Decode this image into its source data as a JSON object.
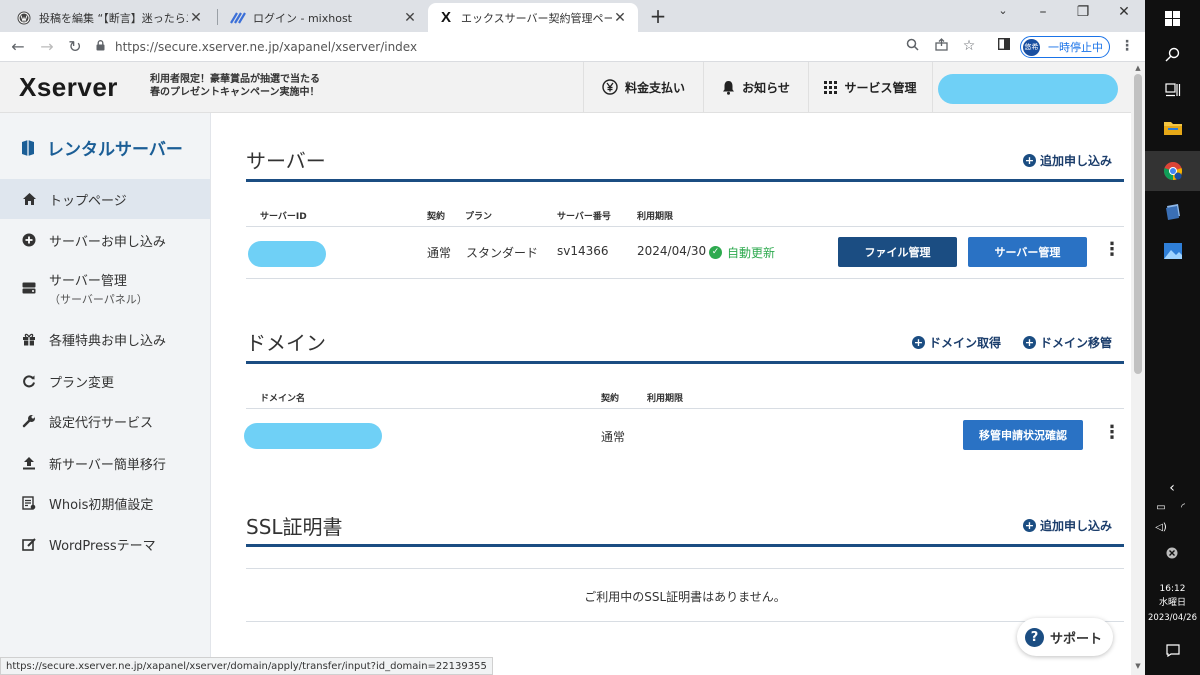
{
  "browser": {
    "tabs": [
      {
        "title": "投稿を編集 “【断言】迷ったらエックス",
        "icon": "wordpress-icon",
        "active": false
      },
      {
        "title": "ログイン - mixhost",
        "icon": "mixhost-icon",
        "active": false
      },
      {
        "title": "エックスサーバー契約管理ページ",
        "icon": "xserver-icon",
        "active": true
      }
    ],
    "url": "https://secure.xserver.ne.jp/xapanel/xserver/index",
    "profile_avatar": "悠希",
    "profile_label": "一時停止中"
  },
  "header": {
    "logo": "Xserver",
    "promo_line1": "利用者限定！豪華賞品が抽選で当たる",
    "promo_line2": "春のプレゼントキャンペーン実施中！",
    "nav": [
      {
        "label": "料金支払い",
        "icon": "yen-icon"
      },
      {
        "label": "お知らせ",
        "icon": "bell-icon"
      },
      {
        "label": "サービス管理",
        "icon": "grid-icon"
      }
    ]
  },
  "sidebar": {
    "title": "レンタルサーバー",
    "items": [
      {
        "label": "トップページ",
        "sub": "",
        "icon": "home-icon",
        "active": true
      },
      {
        "label": "サーバーお申し込み",
        "sub": "",
        "icon": "plus-circle-icon",
        "active": false
      },
      {
        "label": "サーバー管理",
        "sub": "（サーバーパネル）",
        "icon": "server-icon",
        "active": false
      },
      {
        "label": "各種特典お申し込み",
        "sub": "",
        "icon": "gift-icon",
        "active": false
      },
      {
        "label": "プラン変更",
        "sub": "",
        "icon": "refresh-icon",
        "active": false
      },
      {
        "label": "設定代行サービス",
        "sub": "",
        "icon": "wrench-icon",
        "active": false
      },
      {
        "label": "新サーバー簡単移行",
        "sub": "",
        "icon": "upload-icon",
        "active": false
      },
      {
        "label": "Whois初期値設定",
        "sub": "",
        "icon": "whois-icon",
        "active": false
      },
      {
        "label": "WordPressテーマ",
        "sub": "",
        "icon": "edit-icon",
        "active": false
      }
    ]
  },
  "server_section": {
    "title": "サーバー",
    "add_label": "追加申し込み",
    "columns": {
      "id": "サーバーID",
      "contract": "契約",
      "plan": "プラン",
      "number": "サーバー番号",
      "expiry": "利用期限"
    },
    "row": {
      "contract": "通常",
      "plan": "スタンダード",
      "number": "sv14366",
      "expiry": "2024/04/30",
      "renew": "自動更新",
      "file_btn": "ファイル管理",
      "server_btn": "サーバー管理"
    }
  },
  "domain_section": {
    "title": "ドメイン",
    "acquire_label": "ドメイン取得",
    "transfer_label": "ドメイン移管",
    "columns": {
      "name": "ドメイン名",
      "contract": "契約",
      "expiry": "利用期限"
    },
    "row": {
      "contract": "通常",
      "status_btn": "移管申請状況確認"
    }
  },
  "ssl_section": {
    "title": "SSL証明書",
    "add_label": "追加申し込み",
    "empty": "ご利用中のSSL証明書はありません。"
  },
  "support_label": "サポート",
  "status_url": "https://secure.xserver.ne.jp/xapanel/xserver/domain/apply/transfer/input?id_domain=22139355",
  "taskbar": {
    "time": "16:12",
    "weekday": "水曜日",
    "date": "2023/04/26"
  },
  "colors": {
    "accent": "#1b4d82",
    "redaction": "#6fd0f6",
    "renew_green": "#2eaa4f",
    "sidebar_bg": "#f2f4f6"
  }
}
